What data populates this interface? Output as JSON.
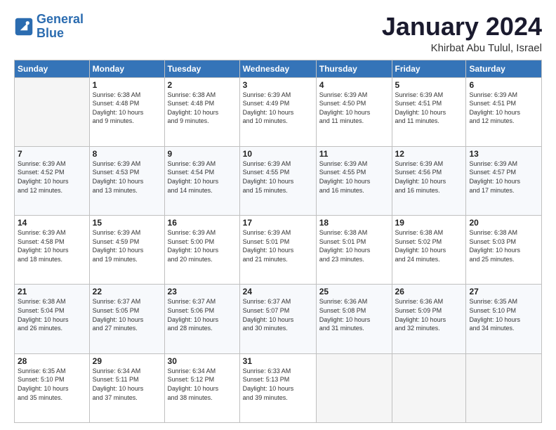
{
  "header": {
    "logo_line1": "General",
    "logo_line2": "Blue",
    "month_year": "January 2024",
    "location": "Khirbat Abu Tulul, Israel"
  },
  "days_of_week": [
    "Sunday",
    "Monday",
    "Tuesday",
    "Wednesday",
    "Thursday",
    "Friday",
    "Saturday"
  ],
  "weeks": [
    [
      {
        "day": "",
        "info": ""
      },
      {
        "day": "1",
        "info": "Sunrise: 6:38 AM\nSunset: 4:48 PM\nDaylight: 10 hours\nand 9 minutes."
      },
      {
        "day": "2",
        "info": "Sunrise: 6:38 AM\nSunset: 4:48 PM\nDaylight: 10 hours\nand 9 minutes."
      },
      {
        "day": "3",
        "info": "Sunrise: 6:39 AM\nSunset: 4:49 PM\nDaylight: 10 hours\nand 10 minutes."
      },
      {
        "day": "4",
        "info": "Sunrise: 6:39 AM\nSunset: 4:50 PM\nDaylight: 10 hours\nand 11 minutes."
      },
      {
        "day": "5",
        "info": "Sunrise: 6:39 AM\nSunset: 4:51 PM\nDaylight: 10 hours\nand 11 minutes."
      },
      {
        "day": "6",
        "info": "Sunrise: 6:39 AM\nSunset: 4:51 PM\nDaylight: 10 hours\nand 12 minutes."
      }
    ],
    [
      {
        "day": "7",
        "info": "Sunrise: 6:39 AM\nSunset: 4:52 PM\nDaylight: 10 hours\nand 12 minutes."
      },
      {
        "day": "8",
        "info": "Sunrise: 6:39 AM\nSunset: 4:53 PM\nDaylight: 10 hours\nand 13 minutes."
      },
      {
        "day": "9",
        "info": "Sunrise: 6:39 AM\nSunset: 4:54 PM\nDaylight: 10 hours\nand 14 minutes."
      },
      {
        "day": "10",
        "info": "Sunrise: 6:39 AM\nSunset: 4:55 PM\nDaylight: 10 hours\nand 15 minutes."
      },
      {
        "day": "11",
        "info": "Sunrise: 6:39 AM\nSunset: 4:55 PM\nDaylight: 10 hours\nand 16 minutes."
      },
      {
        "day": "12",
        "info": "Sunrise: 6:39 AM\nSunset: 4:56 PM\nDaylight: 10 hours\nand 16 minutes."
      },
      {
        "day": "13",
        "info": "Sunrise: 6:39 AM\nSunset: 4:57 PM\nDaylight: 10 hours\nand 17 minutes."
      }
    ],
    [
      {
        "day": "14",
        "info": "Sunrise: 6:39 AM\nSunset: 4:58 PM\nDaylight: 10 hours\nand 18 minutes."
      },
      {
        "day": "15",
        "info": "Sunrise: 6:39 AM\nSunset: 4:59 PM\nDaylight: 10 hours\nand 19 minutes."
      },
      {
        "day": "16",
        "info": "Sunrise: 6:39 AM\nSunset: 5:00 PM\nDaylight: 10 hours\nand 20 minutes."
      },
      {
        "day": "17",
        "info": "Sunrise: 6:39 AM\nSunset: 5:01 PM\nDaylight: 10 hours\nand 21 minutes."
      },
      {
        "day": "18",
        "info": "Sunrise: 6:38 AM\nSunset: 5:01 PM\nDaylight: 10 hours\nand 23 minutes."
      },
      {
        "day": "19",
        "info": "Sunrise: 6:38 AM\nSunset: 5:02 PM\nDaylight: 10 hours\nand 24 minutes."
      },
      {
        "day": "20",
        "info": "Sunrise: 6:38 AM\nSunset: 5:03 PM\nDaylight: 10 hours\nand 25 minutes."
      }
    ],
    [
      {
        "day": "21",
        "info": "Sunrise: 6:38 AM\nSunset: 5:04 PM\nDaylight: 10 hours\nand 26 minutes."
      },
      {
        "day": "22",
        "info": "Sunrise: 6:37 AM\nSunset: 5:05 PM\nDaylight: 10 hours\nand 27 minutes."
      },
      {
        "day": "23",
        "info": "Sunrise: 6:37 AM\nSunset: 5:06 PM\nDaylight: 10 hours\nand 28 minutes."
      },
      {
        "day": "24",
        "info": "Sunrise: 6:37 AM\nSunset: 5:07 PM\nDaylight: 10 hours\nand 30 minutes."
      },
      {
        "day": "25",
        "info": "Sunrise: 6:36 AM\nSunset: 5:08 PM\nDaylight: 10 hours\nand 31 minutes."
      },
      {
        "day": "26",
        "info": "Sunrise: 6:36 AM\nSunset: 5:09 PM\nDaylight: 10 hours\nand 32 minutes."
      },
      {
        "day": "27",
        "info": "Sunrise: 6:35 AM\nSunset: 5:10 PM\nDaylight: 10 hours\nand 34 minutes."
      }
    ],
    [
      {
        "day": "28",
        "info": "Sunrise: 6:35 AM\nSunset: 5:10 PM\nDaylight: 10 hours\nand 35 minutes."
      },
      {
        "day": "29",
        "info": "Sunrise: 6:34 AM\nSunset: 5:11 PM\nDaylight: 10 hours\nand 37 minutes."
      },
      {
        "day": "30",
        "info": "Sunrise: 6:34 AM\nSunset: 5:12 PM\nDaylight: 10 hours\nand 38 minutes."
      },
      {
        "day": "31",
        "info": "Sunrise: 6:33 AM\nSunset: 5:13 PM\nDaylight: 10 hours\nand 39 minutes."
      },
      {
        "day": "",
        "info": ""
      },
      {
        "day": "",
        "info": ""
      },
      {
        "day": "",
        "info": ""
      }
    ]
  ]
}
